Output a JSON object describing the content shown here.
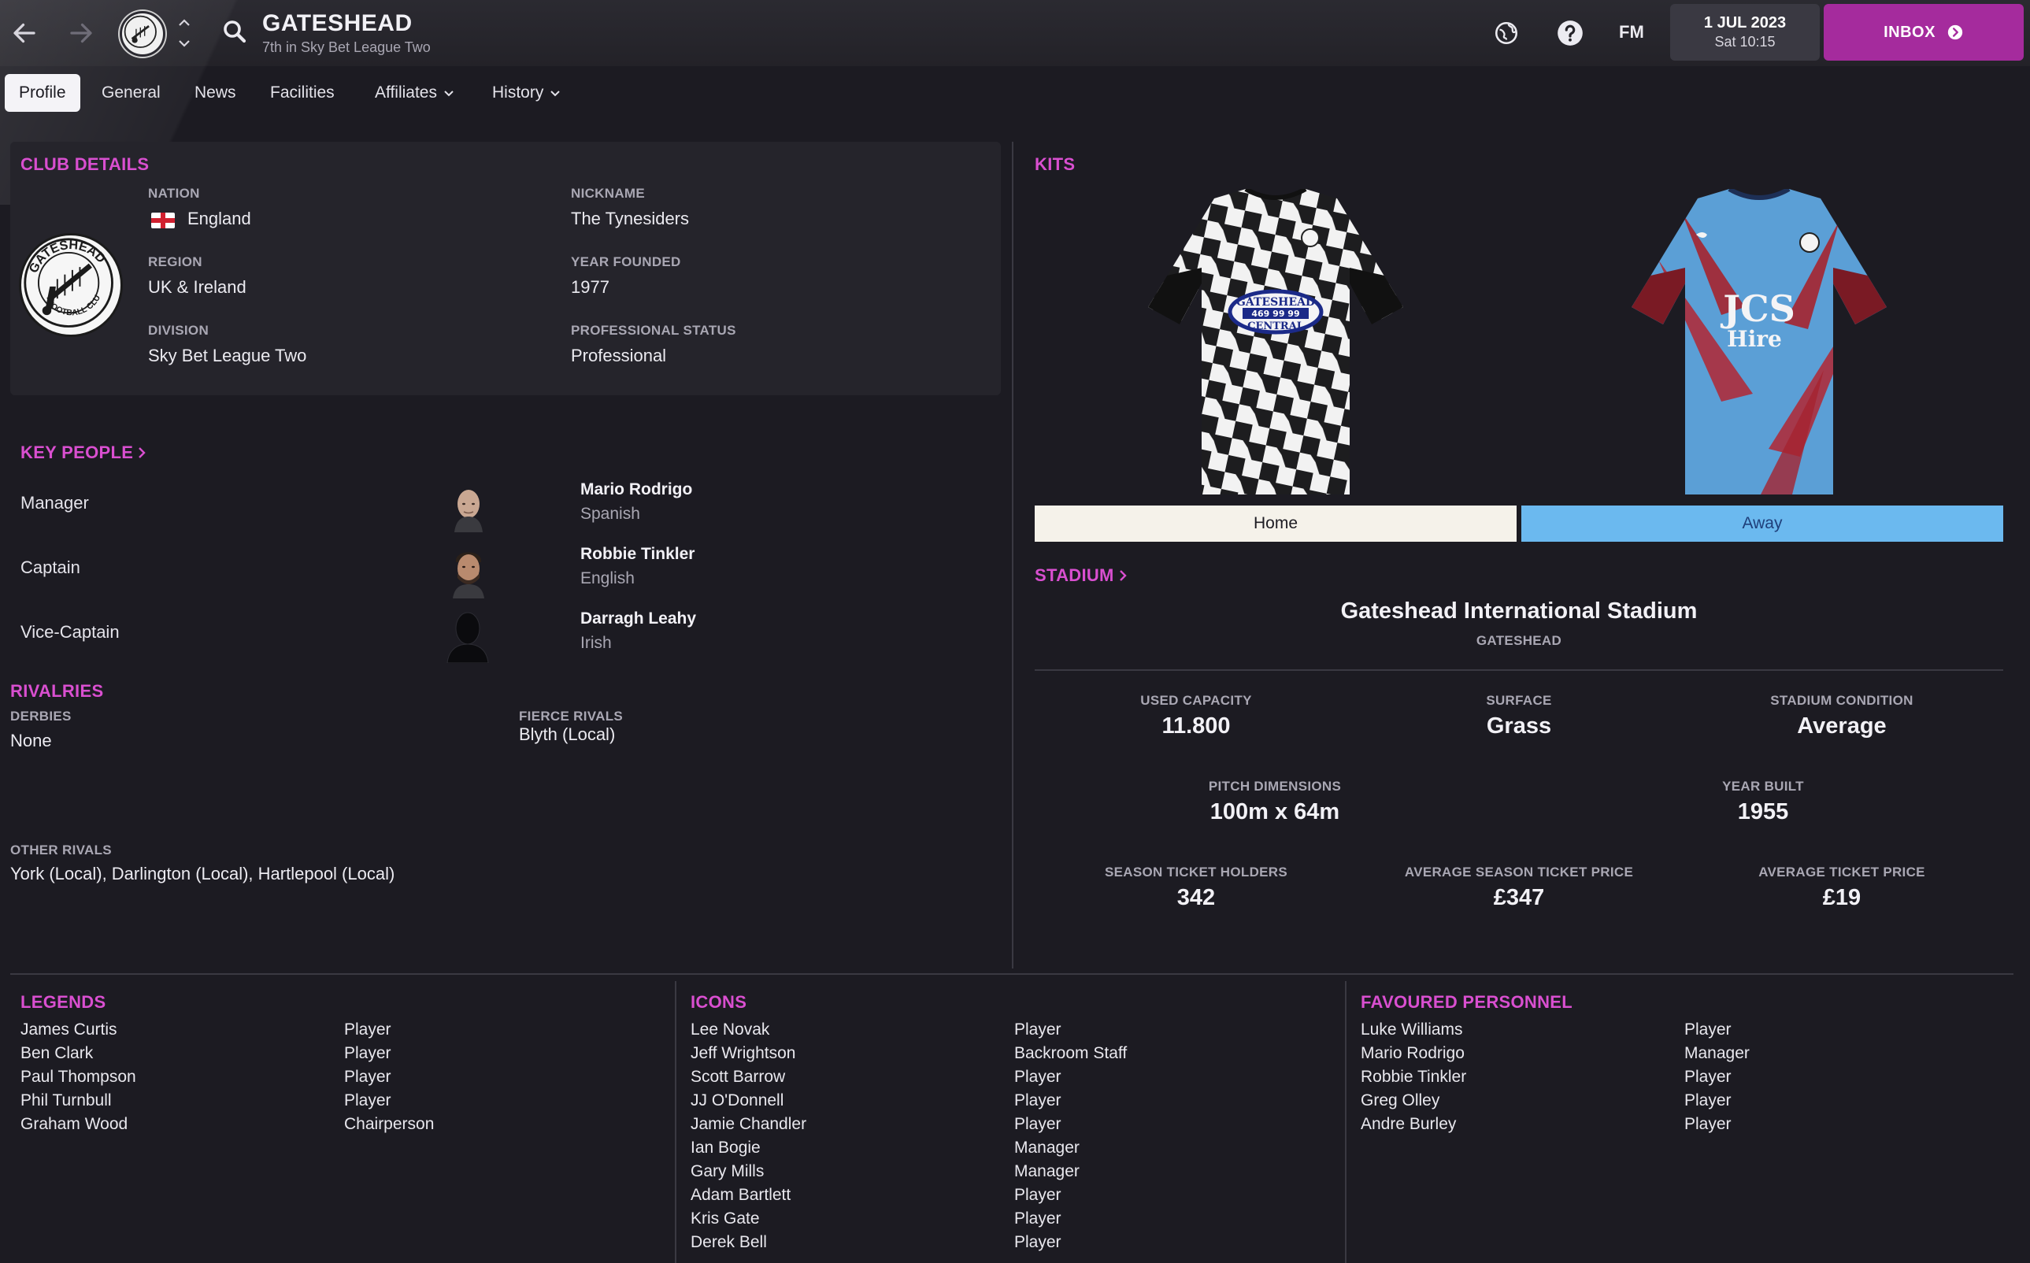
{
  "header": {
    "club_name": "GATESHEAD",
    "club_position": "7th in Sky Bet League Two",
    "date": "1 JUL 2023",
    "day_time": "Sat 10:15",
    "fm_label": "FM",
    "inbox_label": "INBOX",
    "accent_color": "#a52b9d"
  },
  "tabs": [
    {
      "label": "Profile",
      "active": true
    },
    {
      "label": "General"
    },
    {
      "label": "News"
    },
    {
      "label": "Facilities"
    },
    {
      "label": "Affiliates"
    },
    {
      "label": "History"
    }
  ],
  "club_details": {
    "heading": "CLUB DETAILS",
    "badge_text_top": "GATESHEAD",
    "badge_text_bottom": "FOOTBALL CLUB",
    "nation_label": "NATION",
    "nation_value": "England",
    "region_label": "REGION",
    "region_value": "UK & Ireland",
    "division_label": "DIVISION",
    "division_value": "Sky Bet League Two",
    "nickname_label": "NICKNAME",
    "nickname_value": "The Tynesiders",
    "founded_label": "YEAR FOUNDED",
    "founded_value": "1977",
    "status_label": "PROFESSIONAL STATUS",
    "status_value": "Professional"
  },
  "key_people": {
    "heading": "KEY PEOPLE",
    "people": [
      {
        "role": "Manager",
        "name": "Mario Rodrigo",
        "nationality": "Spanish"
      },
      {
        "role": "Captain",
        "name": "Robbie Tinkler",
        "nationality": "English"
      },
      {
        "role": "Vice-Captain",
        "name": "Darragh Leahy",
        "nationality": "Irish"
      }
    ]
  },
  "rivalries": {
    "heading": "RIVALRIES",
    "derbies_label": "DERBIES",
    "derbies_value": "None",
    "fierce_label": "FIERCE RIVALS",
    "fierce_value": "Blyth (Local)",
    "other_label": "OTHER RIVALS",
    "other_value": "York (Local), Darlington (Local), Hartlepool (Local)"
  },
  "kits": {
    "heading": "KITS",
    "home_label": "Home",
    "away_label": "Away",
    "home_sponsor_line1": "GATESHEAD",
    "home_sponsor_line2": "469 99 99",
    "home_sponsor_line3": "CENTRAL",
    "away_sponsor_line1": "JCS",
    "away_sponsor_line2": "Hire"
  },
  "stadium": {
    "heading": "STADIUM",
    "name": "Gateshead International Stadium",
    "city": "GATESHEAD",
    "capacity_label": "USED CAPACITY",
    "capacity_value": "11.800",
    "surface_label": "SURFACE",
    "surface_value": "Grass",
    "condition_label": "STADIUM CONDITION",
    "condition_value": "Average",
    "pitch_label": "PITCH DIMENSIONS",
    "pitch_value": "100m x 64m",
    "built_label": "YEAR BUILT",
    "built_value": "1955",
    "season_holders_label": "SEASON TICKET HOLDERS",
    "season_holders_value": "342",
    "avg_season_label": "AVERAGE SEASON TICKET PRICE",
    "avg_season_value": "£347",
    "avg_ticket_label": "AVERAGE TICKET PRICE",
    "avg_ticket_value": "£19"
  },
  "legends": {
    "heading": "LEGENDS",
    "items": [
      {
        "name": "James Curtis",
        "role": "Player"
      },
      {
        "name": "Ben Clark",
        "role": "Player"
      },
      {
        "name": "Paul Thompson",
        "role": "Player"
      },
      {
        "name": "Phil Turnbull",
        "role": "Player"
      },
      {
        "name": "Graham Wood",
        "role": "Chairperson"
      }
    ]
  },
  "icons": {
    "heading": "ICONS",
    "items": [
      {
        "name": "Lee Novak",
        "role": "Player"
      },
      {
        "name": "Jeff Wrightson",
        "role": "Backroom Staff"
      },
      {
        "name": "Scott Barrow",
        "role": "Player"
      },
      {
        "name": "JJ O'Donnell",
        "role": "Player"
      },
      {
        "name": "Jamie Chandler",
        "role": "Player"
      },
      {
        "name": "Ian Bogie",
        "role": "Manager"
      },
      {
        "name": "Gary Mills",
        "role": "Manager"
      },
      {
        "name": "Adam Bartlett",
        "role": "Player"
      },
      {
        "name": "Kris Gate",
        "role": "Player"
      },
      {
        "name": "Derek Bell",
        "role": "Player"
      }
    ]
  },
  "favoured": {
    "heading": "FAVOURED PERSONNEL",
    "items": [
      {
        "name": "Luke Williams",
        "role": "Player"
      },
      {
        "name": "Mario Rodrigo",
        "role": "Manager"
      },
      {
        "name": "Robbie Tinkler",
        "role": "Player"
      },
      {
        "name": "Greg Olley",
        "role": "Player"
      },
      {
        "name": "Andre Burley",
        "role": "Player"
      }
    ]
  }
}
